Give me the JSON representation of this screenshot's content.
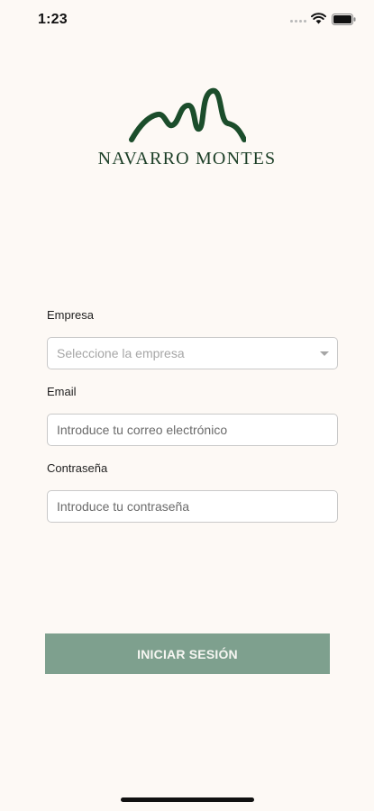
{
  "status_bar": {
    "time": "1:23"
  },
  "logo": {
    "brand_name": "NAVARRO MONTES",
    "color": "#1b4d2b"
  },
  "form": {
    "company": {
      "label": "Empresa",
      "placeholder": "Seleccione la empresa"
    },
    "email": {
      "label": "Email",
      "placeholder": "Introduce tu correo electrónico"
    },
    "password": {
      "label": "Contraseña",
      "placeholder": "Introduce tu contraseña"
    },
    "submit_label": "INICIAR SESIÓN"
  },
  "colors": {
    "background": "#fdf9f5",
    "button": "#7ea08e",
    "brand": "#1b4d2b"
  }
}
